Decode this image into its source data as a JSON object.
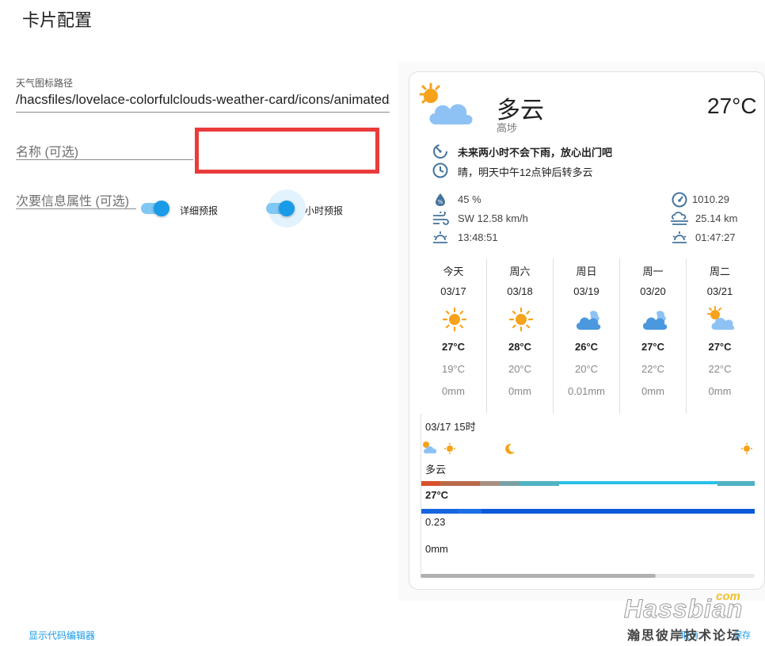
{
  "dialog": {
    "title": "卡片配置"
  },
  "form": {
    "icon_path_label": "天气图标路径",
    "icon_path_value": "/hacsfiles/lovelace-colorfulclouds-weather-card/icons/animated/",
    "name_label": "名称 (可选)",
    "secondary_label": "次要信息属性 (可选)",
    "toggle_daily_label": "详细预报",
    "toggle_hourly_label": "小时预报"
  },
  "footer": {
    "show_code": "显示代码编辑器",
    "cancel": "取消",
    "save": "保存"
  },
  "weather": {
    "condition": "多云",
    "location": "高埗",
    "temperature": "27°C",
    "alert_primary": "未来两小时不会下雨，放心出门吧",
    "alert_secondary": "晴，明天中午12点钟后转多云",
    "stats": {
      "humidity": "45 %",
      "wind": "SW 12.58 km/h",
      "sunrise": "13:48:51",
      "pressure": "1010.29",
      "visibility": "25.14 km",
      "sunset": "01:47:27"
    },
    "forecast": [
      {
        "day": "今天",
        "date": "03/17",
        "icon": "sunny-icon",
        "high": "27°C",
        "low": "19°C",
        "rain": "0mm"
      },
      {
        "day": "周六",
        "date": "03/18",
        "icon": "sunny-icon",
        "high": "28°C",
        "low": "20°C",
        "rain": "0mm"
      },
      {
        "day": "周日",
        "date": "03/19",
        "icon": "cloudy-icon",
        "high": "26°C",
        "low": "20°C",
        "rain": "0.01mm"
      },
      {
        "day": "周一",
        "date": "03/20",
        "icon": "cloudy-icon",
        "high": "27°C",
        "low": "22°C",
        "rain": "0mm"
      },
      {
        "day": "周二",
        "date": "03/21",
        "icon": "partly-cloudy-icon",
        "high": "27°C",
        "low": "22°C",
        "rain": "0mm"
      }
    ],
    "hourly": {
      "time": "03/17 15时",
      "condition": "多云",
      "temperature": "27°C",
      "probability": "0.23",
      "precipitation": "0mm"
    }
  },
  "watermark": {
    "brand": "Hassbian",
    "tld": "com",
    "cn": "瀚思彼岸技术论坛"
  },
  "colors": {
    "accent": "#1a9be8",
    "highlight_box": "#ea3b3b",
    "sun": "#f7a21b",
    "cloud": "#8ec2f5"
  }
}
